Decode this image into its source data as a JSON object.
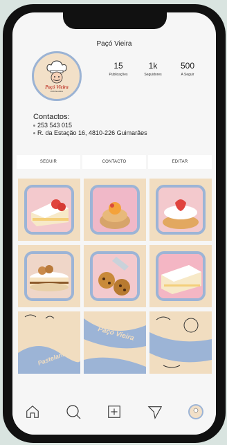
{
  "profile": {
    "username": "Paçó Vieira",
    "logo_text": "Paçó Vieira",
    "logo_subtext": "PASTELARIA"
  },
  "stats": [
    {
      "value": "15",
      "label": "Publicações"
    },
    {
      "value": "1k",
      "label": "Seguidores"
    },
    {
      "value": "500",
      "label": "A Seguir"
    }
  ],
  "contacts": {
    "title": "Contactos:",
    "phone": "253 543 015",
    "address": "R. da Estação 16, 4810-226 Guimarães"
  },
  "actions": {
    "follow": "SEGUIR",
    "contact": "CONTACTO",
    "edit": "EDITAR"
  },
  "grid_art": {
    "brand": "Paçó Vieira",
    "word": "Pastelaria"
  },
  "colors": {
    "accent_blue": "#9cb4d6",
    "cream": "#f1ddc0",
    "pink": "#f3c9cd"
  },
  "tabbar": [
    "home-icon",
    "search-icon",
    "add-post-icon",
    "send-icon",
    "profile-avatar"
  ]
}
